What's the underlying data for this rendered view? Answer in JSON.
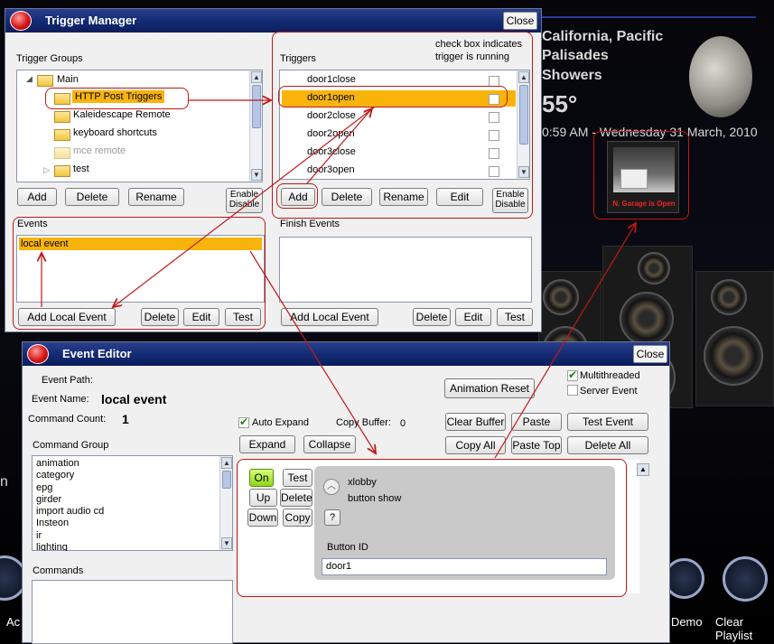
{
  "background": {
    "weather_location": "California, Pacific Palisades",
    "weather_line1": "California, Pacific",
    "weather_line2": "Palisades",
    "weather_condition": "Showers",
    "temperature": "55°",
    "datetime": "0:59 AM - Wednesday 31 March, 2010",
    "garage_caption": "N. Garage is Open",
    "dock_labels": [
      "Ac",
      "r Demo",
      "Clear Playlist"
    ],
    "left_fragment": "n"
  },
  "trigger_manager": {
    "title": "Trigger Manager",
    "close_label": "Close",
    "groups_label": "Trigger Groups",
    "groups": [
      {
        "label": "Main",
        "level": 0,
        "expanded": true
      },
      {
        "label": "HTTP Post Triggers",
        "level": 1,
        "selected": true
      },
      {
        "label": "Kaleidescape Remote",
        "level": 1
      },
      {
        "label": "keyboard shortcuts",
        "level": 1
      },
      {
        "label": "mce remote",
        "level": 1,
        "dimmed": true
      },
      {
        "label": "test",
        "level": 1,
        "collapsed": true
      }
    ],
    "group_buttons": {
      "add": "Add",
      "delete": "Delete",
      "rename": "Rename",
      "enable_disable_1": "Enable",
      "enable_disable_2": "Disable"
    },
    "triggers_label": "Triggers",
    "note_line1": "check box indicates",
    "note_line2": "trigger is running",
    "triggers": [
      {
        "label": "door1close",
        "running": false
      },
      {
        "label": "door1open",
        "running": false,
        "selected": true
      },
      {
        "label": "door2close",
        "running": false
      },
      {
        "label": "door2open",
        "running": false
      },
      {
        "label": "door3close",
        "running": false
      },
      {
        "label": "door3open",
        "running": false
      }
    ],
    "trigger_buttons": {
      "add": "Add",
      "delete": "Delete",
      "rename": "Rename",
      "edit": "Edit",
      "enable_disable_1": "Enable",
      "enable_disable_2": "Disable"
    },
    "events_label": "Events",
    "events": [
      {
        "label": "local event",
        "selected": true
      }
    ],
    "event_buttons": {
      "add_local": "Add Local Event",
      "delete": "Delete",
      "edit": "Edit",
      "test": "Test"
    },
    "finish_events_label": "Finish Events",
    "finish_buttons": {
      "add_local": "Add Local Event",
      "delete": "Delete",
      "edit": "Edit",
      "test": "Test"
    }
  },
  "event_editor": {
    "title": "Event Editor",
    "close_label": "Close",
    "event_path_label": "Event Path:",
    "event_name_label": "Event Name:",
    "event_name_value": "local event",
    "command_count_label": "Command Count:",
    "command_count_value": "1",
    "animation_reset": "Animation Reset",
    "multithreaded_label": "Multithreaded",
    "multithreaded_checked": true,
    "server_event_label": "Server Event",
    "server_event_checked": false,
    "auto_expand_label": "Auto Expand",
    "auto_expand_checked": true,
    "copy_buffer_label": "Copy Buffer:",
    "copy_buffer_value": "0",
    "buttons": {
      "expand": "Expand",
      "collapse": "Collapse",
      "clear_buffer": "Clear Buffer",
      "paste": "Paste",
      "test_event": "Test Event",
      "copy_all": "Copy All",
      "paste_top": "Paste Top",
      "delete_all": "Delete All"
    },
    "command_group_label": "Command Group",
    "command_groups": [
      "animation",
      "category",
      "epg",
      "girder",
      "import audio cd",
      "Insteon",
      "ir",
      "lighting"
    ],
    "commands_label": "Commands",
    "command_card": {
      "on_label": "On",
      "test_label": "Test",
      "up_label": "Up",
      "delete_label": "Delete",
      "down_label": "Down",
      "copy_label": "Copy",
      "plugin": "xlobby",
      "action": "button show",
      "help": "?",
      "param_label": "Button ID",
      "param_value": "door1"
    }
  }
}
